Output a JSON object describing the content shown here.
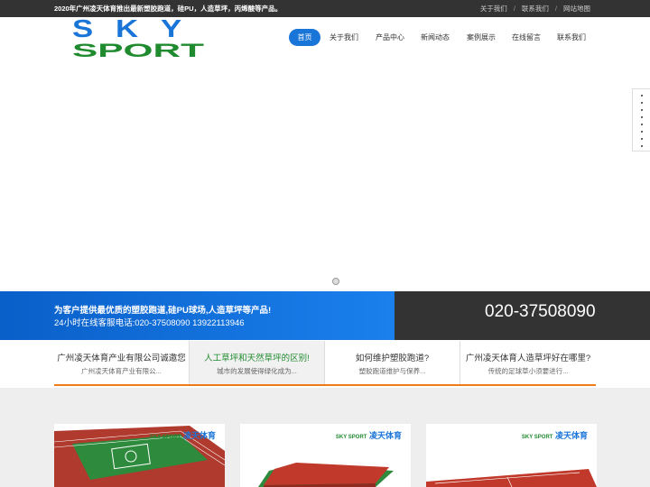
{
  "topbar": {
    "notice": "2020年广州凌天体育推出最新塑胶跑道，硅PU，人造草坪，丙烯酸等产品。",
    "links": [
      "关于我们",
      "联系我们",
      "网站地图"
    ],
    "separator": "/"
  },
  "logo": {
    "line1": "SKY",
    "line2": "SPORT",
    "color_top": "#1a75d9",
    "color_bottom": "#1f8a2e"
  },
  "nav": {
    "items": [
      "首页",
      "关于我们",
      "产品中心",
      "新闻动态",
      "案例展示",
      "在线留言",
      "联系我们"
    ],
    "active_color": "#1a75d9"
  },
  "contact": {
    "line1": "为客户提供最优质的塑胶跑道,硅PU球场,人造草坪等产品!",
    "line2": "24小时在线客服电话:020-37508090 13922113946",
    "phone": "020-37508090"
  },
  "news": [
    {
      "title": "广州凌天体育产业有限公司诚邀您",
      "desc": "广州凌天体育产业有限公..."
    },
    {
      "title": "人工草坪和天然草坪的区别!",
      "desc": "城市的发展使得绿化成为..."
    },
    {
      "title": "如何维护塑胶跑道?",
      "desc": "塑胶跑道维护与保养..."
    },
    {
      "title": "广州凌天体育人造草坪好在哪里?",
      "desc": "传统的足球草小须要进行..."
    }
  ],
  "product_cards": [
    {
      "brand": "凌天体育",
      "brand_small": "SKY SPORT",
      "image": "red running track field"
    },
    {
      "brand": "凌天体育",
      "brand_small": "SKY SPORT",
      "image": "red rubber track sample block"
    },
    {
      "brand": "凌天体育",
      "brand_small": "SKY SPORT",
      "image": "red basketball court"
    }
  ],
  "colors": {
    "accent_blue": "#1a75d9",
    "dark": "#333333",
    "orange": "#f07a16",
    "green": "#1f8a2e",
    "track_red": "#c0392b"
  }
}
